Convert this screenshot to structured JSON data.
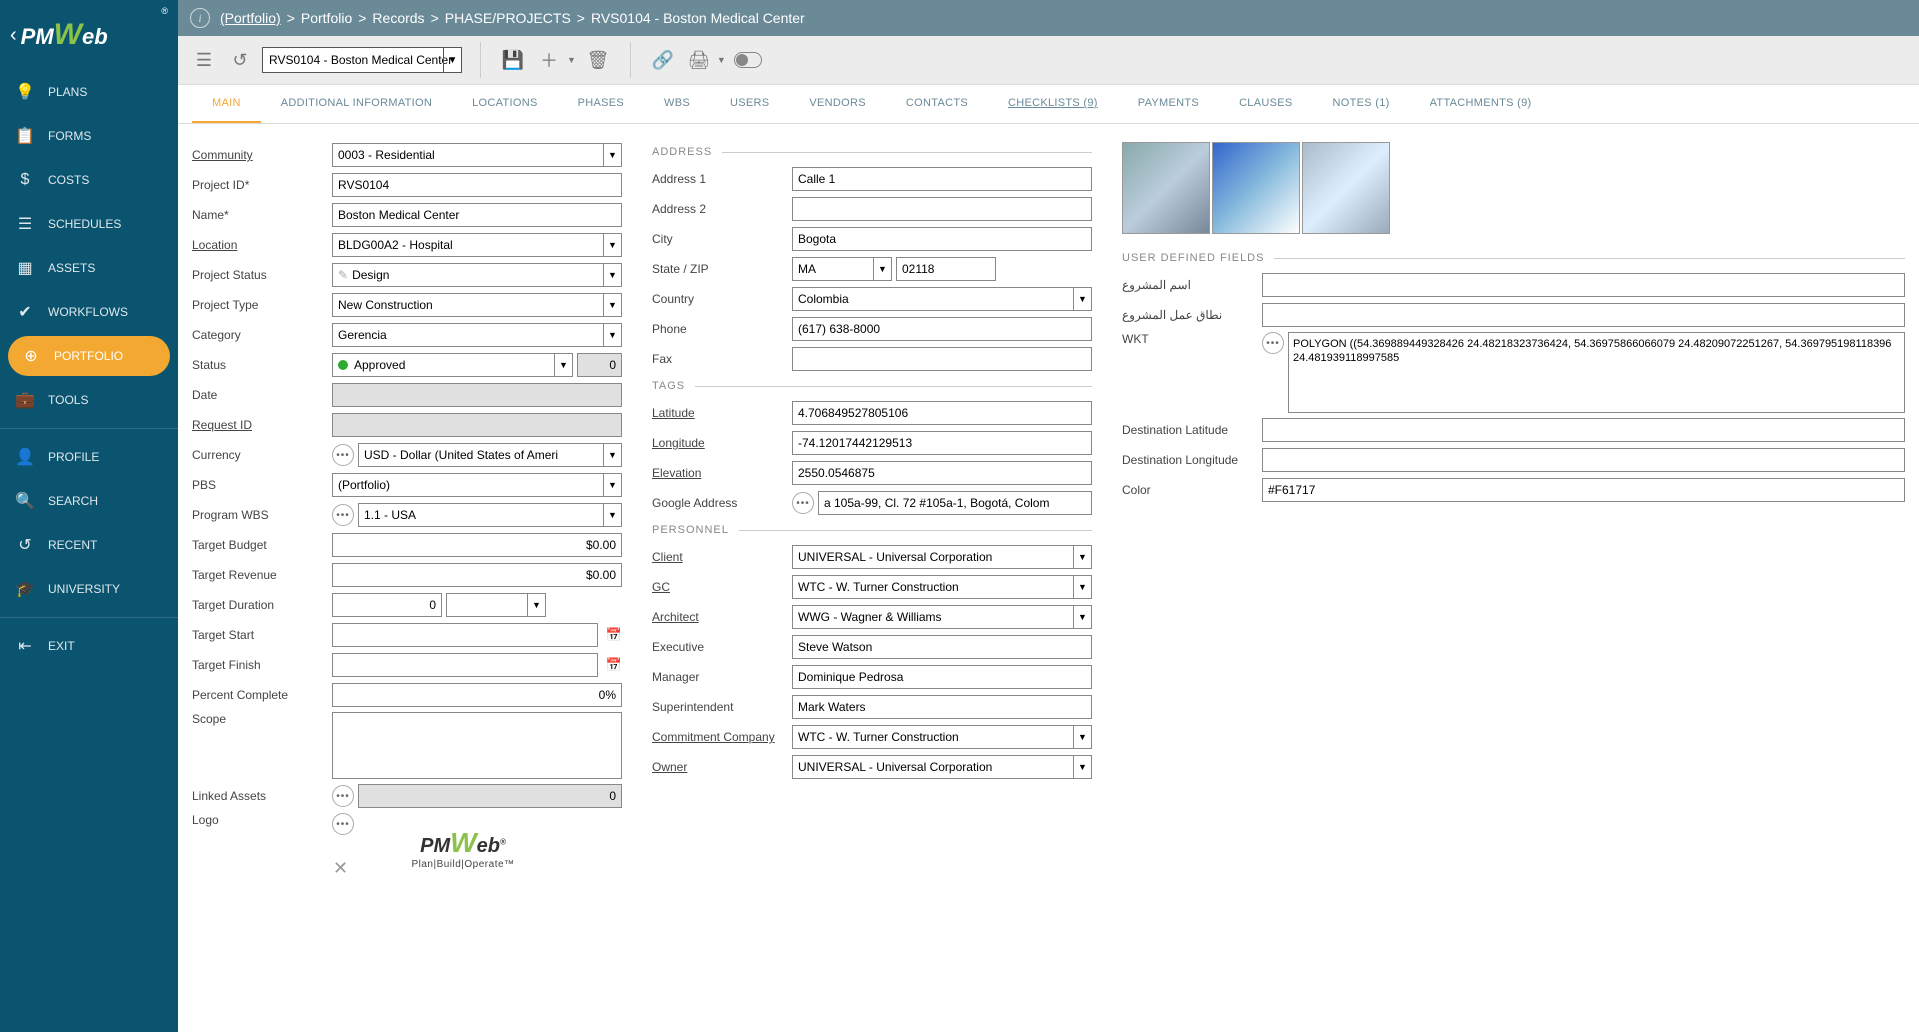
{
  "breadcrumb": {
    "root": "(Portfolio)",
    "parts": [
      "Portfolio",
      "Records",
      "PHASE/PROJECTS",
      "RVS0104 - Boston Medical Center"
    ]
  },
  "toolbar": {
    "record_selector": "RVS0104 - Boston Medical Center"
  },
  "sidebar": {
    "items": [
      {
        "label": "PLANS",
        "icon": "💡"
      },
      {
        "label": "FORMS",
        "icon": "📋"
      },
      {
        "label": "COSTS",
        "icon": "$"
      },
      {
        "label": "SCHEDULES",
        "icon": "☰"
      },
      {
        "label": "ASSETS",
        "icon": "▦"
      },
      {
        "label": "WORKFLOWS",
        "icon": "✔"
      },
      {
        "label": "PORTFOLIO",
        "icon": "⊕"
      },
      {
        "label": "TOOLS",
        "icon": "💼"
      },
      {
        "label": "PROFILE",
        "icon": "👤"
      },
      {
        "label": "SEARCH",
        "icon": "🔍"
      },
      {
        "label": "RECENT",
        "icon": "↺"
      },
      {
        "label": "UNIVERSITY",
        "icon": "🎓"
      },
      {
        "label": "EXIT",
        "icon": "⇤"
      }
    ]
  },
  "tabs": [
    {
      "label": "MAIN",
      "active": true
    },
    {
      "label": "ADDITIONAL INFORMATION"
    },
    {
      "label": "LOCATIONS"
    },
    {
      "label": "PHASES"
    },
    {
      "label": "WBS"
    },
    {
      "label": "USERS"
    },
    {
      "label": "VENDORS"
    },
    {
      "label": "CONTACTS"
    },
    {
      "label": "CHECKLISTS (9)",
      "link": true
    },
    {
      "label": "PAYMENTS"
    },
    {
      "label": "CLAUSES"
    },
    {
      "label": "NOTES (1)"
    },
    {
      "label": "ATTACHMENTS (9)"
    }
  ],
  "labels": {
    "community": "Community",
    "project_id": "Project ID",
    "name": "Name",
    "location": "Location",
    "project_status": "Project Status",
    "project_type": "Project Type",
    "category": "Category",
    "status": "Status",
    "date": "Date",
    "request_id": "Request ID",
    "currency": "Currency",
    "pbs": "PBS",
    "program_wbs": "Program WBS",
    "target_budget": "Target Budget",
    "target_revenue": "Target Revenue",
    "target_duration": "Target Duration",
    "target_start": "Target Start",
    "target_finish": "Target Finish",
    "percent_complete": "Percent Complete",
    "scope": "Scope",
    "linked_assets": "Linked Assets",
    "logo": "Logo",
    "address_hdr": "ADDRESS",
    "address1": "Address 1",
    "address2": "Address 2",
    "city": "City",
    "state_zip": "State / ZIP",
    "country": "Country",
    "phone": "Phone",
    "fax": "Fax",
    "tags_hdr": "TAGS",
    "latitude": "Latitude",
    "longitude": "Longitude",
    "elevation": "Elevation",
    "google_address": "Google Address",
    "personnel_hdr": "PERSONNEL",
    "client": "Client",
    "gc": "GC",
    "architect": "Architect",
    "executive": "Executive",
    "manager": "Manager",
    "superintendent": "Superintendent",
    "commitment_company": "Commitment Company",
    "owner": "Owner",
    "udf_hdr": "USER DEFINED FIELDS",
    "udf1": "اسم المشروع",
    "udf2": "نطاق عمل المشروع",
    "wkt": "WKT",
    "dest_lat": "Destination Latitude",
    "dest_lng": "Destination Longitude",
    "color": "Color"
  },
  "form": {
    "community": "0003 - Residential",
    "project_id": "RVS0104",
    "name": "Boston Medical Center",
    "location": "BLDG00A2 - Hospital",
    "project_status": "Design",
    "project_type": "New Construction",
    "category": "Gerencia",
    "status": "Approved",
    "status_num": "0",
    "date": "",
    "request_id": "",
    "currency": "USD - Dollar (United States of Ameri",
    "pbs": "(Portfolio)",
    "program_wbs": "1.1 - USA",
    "target_budget": "$0.00",
    "target_revenue": "$0.00",
    "target_duration": "0",
    "target_start": "",
    "target_finish": "",
    "percent_complete": "0%",
    "scope": "",
    "linked_assets": "0",
    "address1": "Calle 1",
    "address2": "",
    "city": "Bogota",
    "state": "MA",
    "zip": "02118",
    "country": "Colombia",
    "phone": "(617) 638-8000",
    "fax": "",
    "latitude": "4.706849527805106",
    "longitude": "-74.12017442129513",
    "elevation": "2550.0546875",
    "google_address": "a 105a-99, Cl. 72 #105a-1, Bogotá, Colom",
    "client": "UNIVERSAL - Universal Corporation",
    "gc": "WTC - W. Turner Construction",
    "architect": "WWG - Wagner & Williams",
    "executive": "Steve Watson",
    "manager": "Dominique Pedrosa",
    "superintendent": "Mark Waters",
    "commitment_company": "WTC - W. Turner Construction",
    "owner": "UNIVERSAL - Universal Corporation",
    "udf1": "",
    "udf2": "",
    "wkt": "POLYGON ((54.369889449328426 24.48218323736424, 54.36975866066079 24.48209072251267, 54.369795198118396 24.481939118997585",
    "dest_lat": "",
    "dest_lng": "",
    "color": "#F61717"
  },
  "logo_sub": "Plan|Build|Operate™"
}
